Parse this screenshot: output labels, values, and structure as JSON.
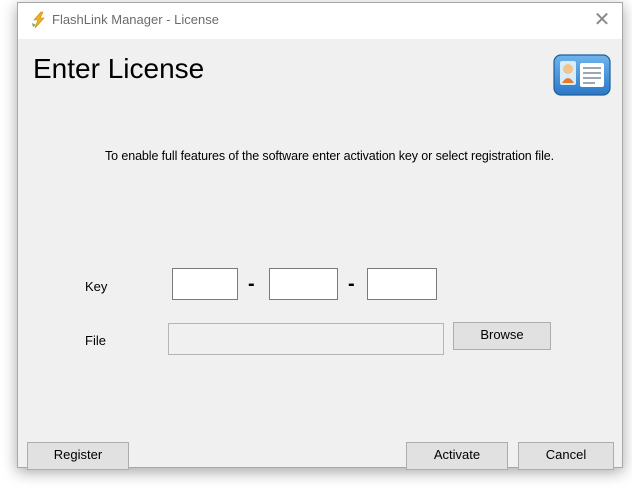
{
  "window": {
    "title": "FlashLink Manager - License",
    "close_glyph": "✕"
  },
  "heading": "Enter License",
  "intro": "To enable full features of the software enter activation key or select registration file.",
  "key": {
    "label": "Key",
    "separator": "-",
    "parts": [
      "",
      "",
      ""
    ]
  },
  "file": {
    "label": "File",
    "value": "",
    "browse_label": "Browse"
  },
  "footer": {
    "register_label": "Register",
    "activate_label": "Activate",
    "cancel_label": "Cancel"
  },
  "icons": {
    "app": "flashlink-logo-icon",
    "license": "license-card-icon"
  }
}
